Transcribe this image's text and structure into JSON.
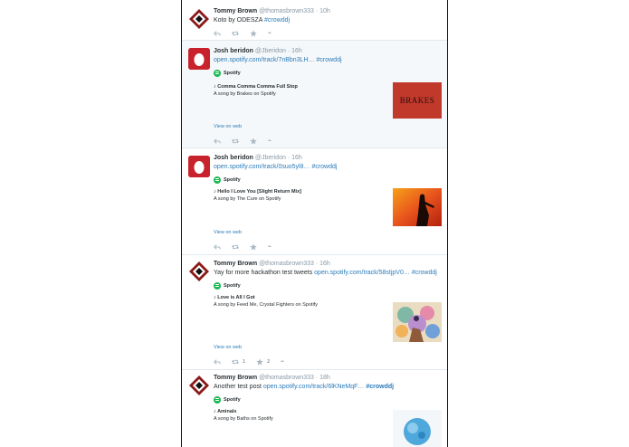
{
  "tweets": [
    {
      "name": "Tommy Brown",
      "handle": "@thomasbrown333",
      "sep": "·",
      "time": "10h",
      "text": "Koto by ODESZA ",
      "hashtag": "#crowddj",
      "avatar": "tommy-avatar"
    },
    {
      "name": "Josh beridon",
      "handle": "@Jberidon",
      "sep": "·",
      "time": "16h",
      "link": "open.spotify.com/track/7nBbn3LH…",
      "hashtag": "#crowddj",
      "card_source": "Spotify",
      "song": "♪ Comma Comma Comma Full Stop",
      "song_desc": "A song by Brakes on Spotify",
      "thumb_text": "BRAKES",
      "view_web": "View on web",
      "avatar": "egg-avatar"
    },
    {
      "name": "Josh beridon",
      "handle": "@Jberidon",
      "sep": "·",
      "time": "16h",
      "link": "open.spotify.com/track/0suo5yl8…",
      "hashtag": "#crowddj",
      "card_source": "Spotify",
      "song": "♪ Hello I Love You [Slight Return Mix]",
      "song_desc": "A song by The Cure on Spotify",
      "view_web": "View on web",
      "avatar": "egg-avatar"
    },
    {
      "name": "Tommy Brown",
      "handle": "@thomasbrown333",
      "sep": "·",
      "time": "16h",
      "text": "Yay for more hackathon test tweets ",
      "link": "open.spotify.com/track/58stjpV0…",
      "hashtag": "#crowddj",
      "card_source": "Spotify",
      "song": "♪ Love is All I Got",
      "song_desc": "A song by Feed Me, Crystal Fighters on Spotify",
      "view_web": "View on web",
      "retweets": "1",
      "favorites": "2",
      "avatar": "tommy-avatar"
    },
    {
      "name": "Tommy Brown",
      "handle": "@thomasbrown333",
      "sep": "·",
      "time": "18h",
      "text": "Another test post ",
      "link": "open.spotify.com/track/6lKNeMqF…",
      "hashtag": "#crowddj",
      "card_source": "Spotify",
      "song": "♪ Aminals",
      "song_desc": "A song by Baths on Spotify",
      "avatar": "tommy-avatar"
    }
  ],
  "actions": {
    "more": "•••"
  },
  "colors": {
    "link": "#2b7bb9",
    "spotify": "#1db954",
    "highlight_bg": "#f5f8fa",
    "meta": "#8899a6"
  }
}
